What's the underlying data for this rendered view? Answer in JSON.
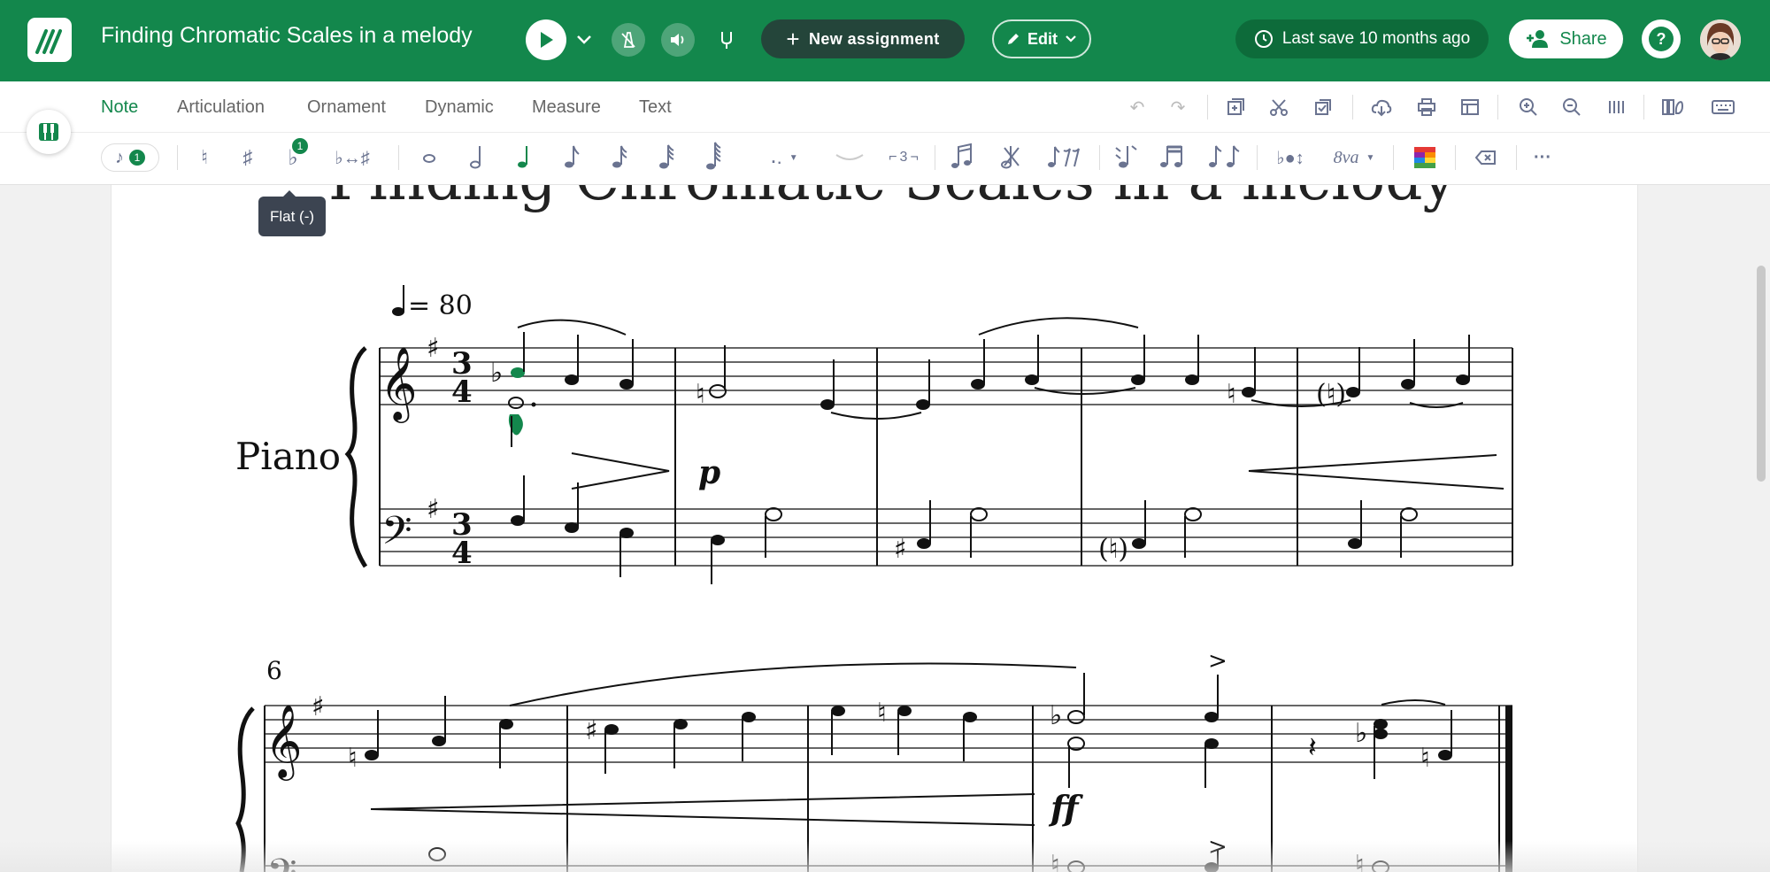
{
  "topbar": {
    "title": "Finding Chromatic Scales in a melody",
    "new_assignment_label": "New assignment",
    "edit_label": "Edit",
    "last_save": "Last save 10 months ago",
    "share_label": "Share",
    "accent_color": "#13874c"
  },
  "tabs": [
    "Note",
    "Articulation",
    "Ornament",
    "Dynamic",
    "Measure",
    "Text"
  ],
  "active_tab": "Note",
  "note_toolbar": {
    "voice_badge": "1",
    "flat_badge": "1",
    "tuplet_label": "3",
    "ottava_label": "8va"
  },
  "tooltip": "Flat (-)",
  "score": {
    "title": "Finding Chromatic Scales in a melody",
    "tempo": "= 80",
    "instrument": "Piano",
    "time_signature_top": "3",
    "time_signature_bottom": "4",
    "dynamic_p": "p",
    "dynamic_ff": "ff",
    "system2_measure_number": "6"
  }
}
